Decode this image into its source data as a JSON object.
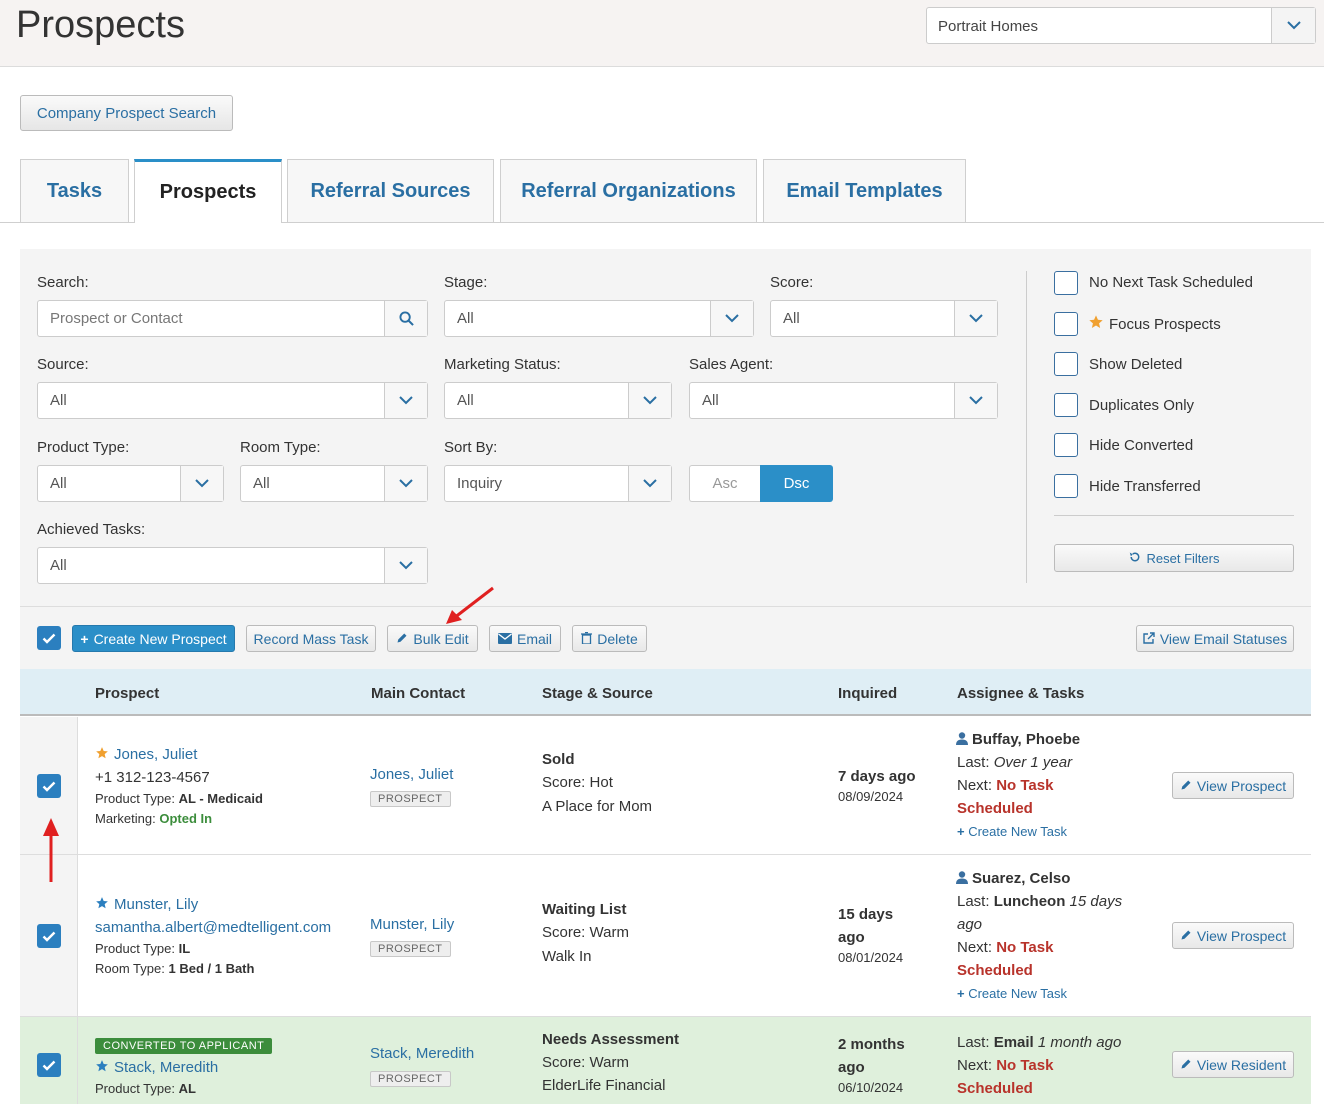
{
  "header": {
    "title": "Prospects",
    "company_value": "Portrait Homes"
  },
  "company_search_label": "Company Prospect Search",
  "tabs": [
    {
      "label": "Tasks"
    },
    {
      "label": "Prospects"
    },
    {
      "label": "Referral Sources"
    },
    {
      "label": "Referral Organizations"
    },
    {
      "label": "Email Templates"
    }
  ],
  "filters": {
    "search_label": "Search:",
    "search_placeholder": "Prospect or Contact",
    "stage_label": "Stage:",
    "stage_value": "All",
    "score_label": "Score:",
    "score_value": "All",
    "source_label": "Source:",
    "source_value": "All",
    "marketing_label": "Marketing Status:",
    "marketing_value": "All",
    "agent_label": "Sales Agent:",
    "agent_value": "All",
    "product_label": "Product Type:",
    "product_value": "All",
    "room_label": "Room Type:",
    "room_value": "All",
    "sort_label": "Sort By:",
    "sort_value": "Inquiry",
    "asc_label": "Asc",
    "dsc_label": "Dsc",
    "achieved_label": "Achieved Tasks:",
    "achieved_value": "All",
    "checkboxes": [
      {
        "label": "No Next Task Scheduled"
      },
      {
        "label": "Focus Prospects"
      },
      {
        "label": "Show Deleted"
      },
      {
        "label": "Duplicates Only"
      },
      {
        "label": "Hide Converted"
      },
      {
        "label": "Hide Transferred"
      }
    ],
    "reset_label": "Reset Filters"
  },
  "actions": {
    "create_label": "Create New Prospect",
    "mass_task_label": "Record Mass Task",
    "bulk_edit_label": "Bulk Edit",
    "email_label": "Email",
    "delete_label": "Delete",
    "email_statuses_label": "View Email Statuses"
  },
  "table": {
    "columns": [
      "Prospect",
      "Main Contact",
      "Stage & Source",
      "Inquired",
      "Assignee & Tasks"
    ],
    "rows": [
      {
        "name": "Jones, Juliet",
        "phone": "+1 312-123-4567",
        "product_label": "Product Type:",
        "product_value": "AL - Medicaid",
        "extra_label": "Marketing:",
        "extra_value": "Opted In",
        "contact": "Jones, Juliet",
        "contact_badge": "PROSPECT",
        "stage": "Sold",
        "score": "Score: Hot",
        "source": "A Place for Mom",
        "inquired_1": "7 days ago",
        "date": "08/09/2024",
        "assignee": "Buffay, Phoebe",
        "last_label": "Last:",
        "last_value": "Over 1 year",
        "next_label": "Next:",
        "next_value_1": "No Task",
        "next_value_2": "Scheduled",
        "create_task": "Create New Task",
        "view_label": "View Prospect",
        "star_color": "#f0a030"
      },
      {
        "name": "Munster, Lily",
        "email": "samantha.albert@medtelligent.com",
        "product_label": "Product Type:",
        "product_value": "IL",
        "extra_label": "Room Type:",
        "extra_value": "1 Bed / 1 Bath",
        "contact": "Munster, Lily",
        "contact_badge": "PROSPECT",
        "stage": "Waiting List",
        "score": "Score: Warm",
        "source": "Walk In",
        "inquired_1": "15 days",
        "inquired_2": "ago",
        "date": "08/01/2024",
        "assignee": "Suarez, Celso",
        "last_label": "Last:",
        "last_value": "Luncheon",
        "last_time_1": "15 days",
        "last_time_2": "ago",
        "next_label": "Next:",
        "next_value_1": "No Task",
        "next_value_2": "Scheduled",
        "create_task": "Create New Task",
        "view_label": "View Prospect",
        "star_color": "#2b7fbf"
      },
      {
        "badge": "CONVERTED TO APPLICANT",
        "name": "Stack, Meredith",
        "product_label": "Product Type:",
        "product_value": "AL",
        "contact": "Stack, Meredith",
        "contact_badge": "PROSPECT",
        "stage": "Needs Assessment",
        "score": "Score: Warm",
        "source": "ElderLife Financial",
        "inquired_1": "2 months",
        "inquired_2": "ago",
        "date": "06/10/2024",
        "last_label": "Last:",
        "last_value": "Email",
        "last_time_1": "1 month ago",
        "next_label": "Next:",
        "next_value_1": "No Task",
        "next_value_2": "Scheduled",
        "view_label": "View Resident",
        "star_color": "#2b7fbf"
      }
    ]
  },
  "colors": {
    "accent": "#2b8fc8",
    "link": "#2a6fa3",
    "danger": "#b8332b",
    "success": "#3c8d3c",
    "annotation": "#e02020"
  }
}
